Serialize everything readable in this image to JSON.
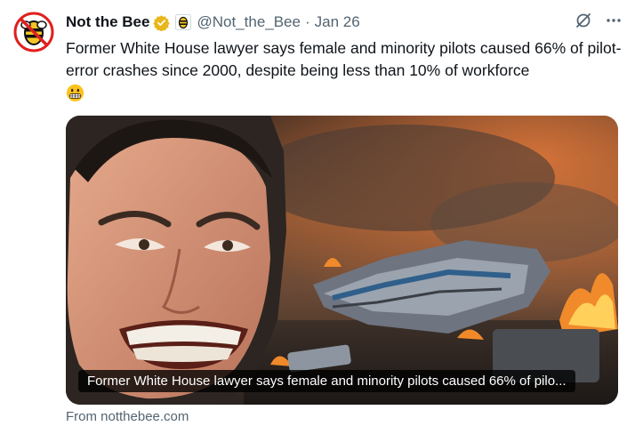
{
  "tweet": {
    "author_name": "Not the Bee",
    "handle": "@Not_the_Bee",
    "separator": "·",
    "date": "Jan 26",
    "text": "Former White House lawyer says female and minority pilots caused 66% of pilot-error crashes since 2000, despite being less than 10% of workforce",
    "emoji": "grimacing-face"
  },
  "card": {
    "caption": "Former White House lawyer says female and minority pilots caused 66% of pilo...",
    "source": "From notthebee.com"
  },
  "icons": {
    "verified": "verified-badge-icon",
    "affiliate": "bee-affiliate-icon",
    "grok": "grok-icon",
    "more": "more-icon"
  },
  "colors": {
    "verified_gold": "#e8b71c",
    "secondary_text": "#536471",
    "avatar_red": "#e0201f"
  }
}
